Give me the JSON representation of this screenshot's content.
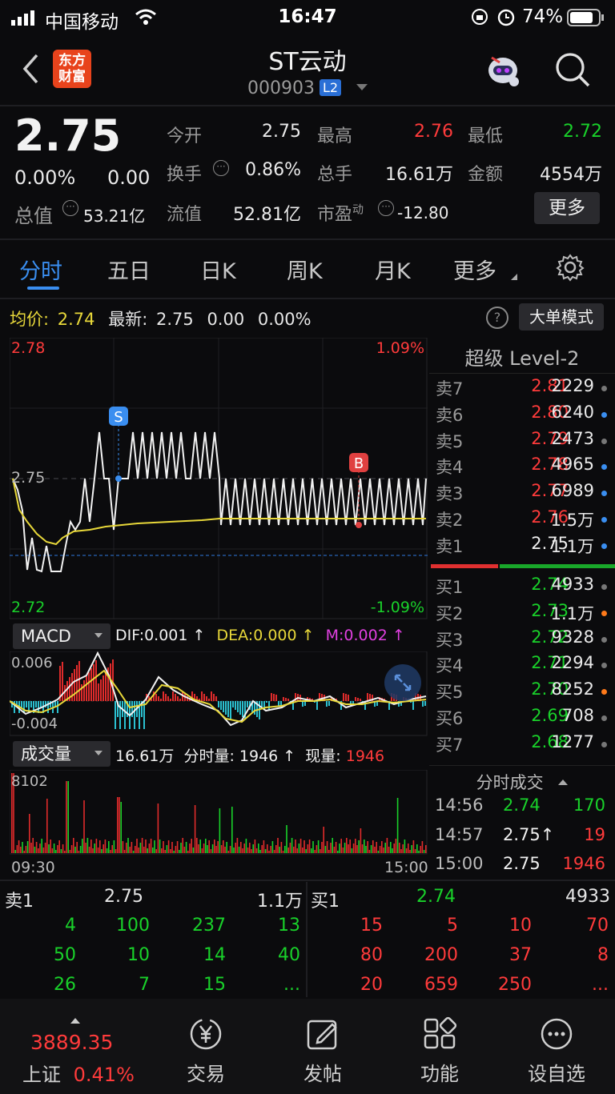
{
  "status_bar": {
    "carrier": "中国移动",
    "time": "16:47",
    "battery": "74%"
  },
  "header": {
    "logo_line1": "东方",
    "logo_line2": "财富",
    "title": "ST云动",
    "code": "000903",
    "level_badge": "L2"
  },
  "quote": {
    "price": "2.75",
    "change_pct": "0.00%",
    "change": "0.00",
    "open_label": "今开",
    "open": "2.75",
    "high_label": "最高",
    "high": "2.76",
    "low_label": "最低",
    "low": "2.72",
    "turnover_label": "换手",
    "turnover": "0.86%",
    "volume_label": "总手",
    "volume": "16.61万",
    "amount_label": "金额",
    "amount": "4554万",
    "total_value_label": "总值",
    "total_value": "53.21亿",
    "float_value_label": "流值",
    "float_value": "52.81亿",
    "pe_label": "市盈",
    "pe_sup": "动",
    "pe": "-12.80",
    "more_button": "更多"
  },
  "tabs": [
    {
      "label": "分时"
    },
    {
      "label": "五日"
    },
    {
      "label": "日K"
    },
    {
      "label": "周K"
    },
    {
      "label": "月K"
    },
    {
      "label": "更多"
    }
  ],
  "info_bar": {
    "avg_label": "均价:",
    "avg": "2.74",
    "latest_label": "最新:",
    "latest": "2.75",
    "chg": "0.00",
    "pct": "0.00%",
    "mode_button": "大单模式"
  },
  "chart": {
    "price_top": "2.78",
    "price_mid": "2.75",
    "price_bottom": "2.72",
    "pct_top": "1.09%",
    "pct_bottom": "-1.09%",
    "marker_s": "S",
    "marker_b": "B"
  },
  "macd": {
    "label": "MACD",
    "dif": "DIF:0.001 ↑",
    "dea": "DEA:0.000 ↑",
    "m": "M:0.002 ↑",
    "axis_top": "0.006",
    "axis_bottom": "-0.004"
  },
  "volume_panel": {
    "label": "成交量",
    "total": "16.61万",
    "minute_label": "分时量:",
    "minute": "1946 ↑",
    "now_label": "现量:",
    "now": "1946",
    "axis_top": "8102",
    "time_start": "09:30",
    "time_end": "15:00"
  },
  "order_book": {
    "title": "超级 Level-2",
    "asks": [
      {
        "label": "卖7",
        "price": "2.81",
        "vol": "2229",
        "dot": "#777777"
      },
      {
        "label": "卖6",
        "price": "2.80",
        "vol": "6240",
        "dot": "#3a8ef0"
      },
      {
        "label": "卖5",
        "price": "2.79",
        "vol": "2473",
        "dot": "#777777"
      },
      {
        "label": "卖4",
        "price": "2.78",
        "vol": "4965",
        "dot": "#3a8ef0"
      },
      {
        "label": "卖3",
        "price": "2.77",
        "vol": "6989",
        "dot": "#3a8ef0"
      },
      {
        "label": "卖2",
        "price": "2.76",
        "vol": "1.5万",
        "dot": "#3a8ef0"
      },
      {
        "label": "卖1",
        "price": "2.75",
        "vol": "1.1万",
        "dot": "#3a8ef0"
      }
    ],
    "bids": [
      {
        "label": "买1",
        "price": "2.74",
        "vol": "4933",
        "dot": "#777777"
      },
      {
        "label": "买2",
        "price": "2.73",
        "vol": "1.1万",
        "dot": "#ff7a1a"
      },
      {
        "label": "买3",
        "price": "2.72",
        "vol": "9328",
        "dot": "#777777"
      },
      {
        "label": "买4",
        "price": "2.71",
        "vol": "2294",
        "dot": "#777777"
      },
      {
        "label": "买5",
        "price": "2.70",
        "vol": "8252",
        "dot": "#ff7a1a"
      },
      {
        "label": "买6",
        "price": "2.69",
        "vol": "708",
        "dot": "#777777"
      },
      {
        "label": "买7",
        "price": "2.68",
        "vol": "1277",
        "dot": "#777777"
      }
    ]
  },
  "ticks": {
    "title": "分时成交",
    "rows": [
      {
        "time": "14:56",
        "price": "2.74",
        "vol": "170"
      },
      {
        "time": "14:57",
        "price": "2.75↑",
        "vol": "19"
      },
      {
        "time": "15:00",
        "price": "2.75",
        "vol": "1946"
      }
    ]
  },
  "queue": {
    "sell_label": "卖1",
    "sell_price": "2.75",
    "sell_vol": "1.1万",
    "buy_label": "买1",
    "buy_price": "2.74",
    "buy_vol": "4933",
    "sell_rows": [
      [
        "4",
        "100",
        "237",
        "13"
      ],
      [
        "50",
        "10",
        "14",
        "40"
      ],
      [
        "26",
        "7",
        "15",
        "..."
      ]
    ],
    "buy_rows": [
      [
        "15",
        "5",
        "10",
        "70"
      ],
      [
        "80",
        "200",
        "37",
        "8"
      ],
      [
        "20",
        "659",
        "250",
        "..."
      ]
    ]
  },
  "bottom_nav": {
    "index_value": "3889.35",
    "index_name": "上证",
    "index_pct": "0.41%",
    "trade": "交易",
    "post": "发帖",
    "functions": "功能",
    "watchlist": "设自选"
  },
  "colors": {
    "up": "#ff3b3b",
    "down": "#19d12a",
    "accent": "#2a8af0",
    "avg_line": "#e8d83a"
  }
}
